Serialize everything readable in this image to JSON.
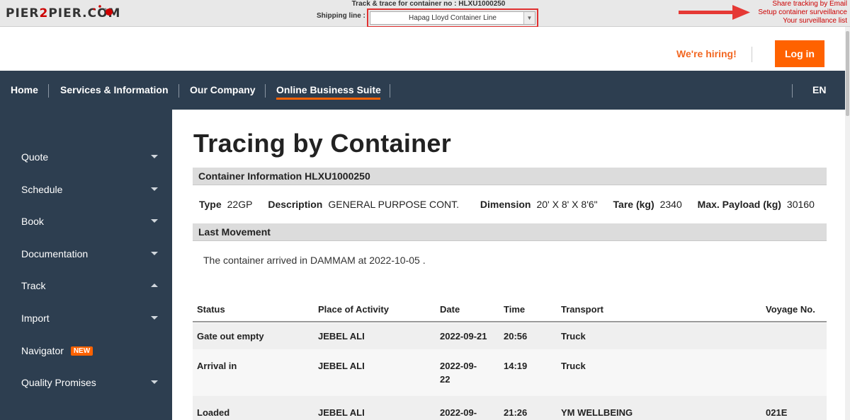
{
  "p2p": {
    "logo_text_a": "PIER",
    "logo_text_b": "2",
    "logo_text_c": "PIER.COM",
    "trace_title": "Track & trace for container no : HLXU1000250",
    "shipping_line_label": "Shipping line :",
    "shipping_line_value": "Hapag Lloyd Container Line",
    "links": [
      "Share tracking by Email",
      "Setup container surveillance",
      "Your surveillance list"
    ]
  },
  "header": {
    "hiring": "We're hiring!",
    "login": "Log in"
  },
  "nav": {
    "items": [
      "Home",
      "Services & Information",
      "Our Company",
      "Online Business Suite"
    ],
    "lang": "EN"
  },
  "sidebar": {
    "items": [
      {
        "label": "Quote",
        "caret": "down"
      },
      {
        "label": "Schedule",
        "caret": "down"
      },
      {
        "label": "Book",
        "caret": "down"
      },
      {
        "label": "Documentation",
        "caret": "down"
      },
      {
        "label": "Track",
        "caret": "up"
      },
      {
        "label": "Import",
        "caret": "down"
      },
      {
        "label": "Navigator",
        "badge": "NEW"
      },
      {
        "label": "Quality Promises",
        "caret": "down"
      }
    ]
  },
  "main": {
    "title": "Tracing by Container",
    "container_info_head": "Container Information HLXU1000250",
    "info": {
      "type_label": "Type",
      "type_value": "22GP",
      "desc_label": "Description",
      "desc_value": "GENERAL PURPOSE CONT.",
      "dim_label": "Dimension",
      "dim_value": "20' X 8' X 8'6\"",
      "tare_label": "Tare (kg)",
      "tare_value": "2340",
      "payload_label": "Max. Payload (kg)",
      "payload_value": "30160"
    },
    "last_movement_head": "Last Movement",
    "last_movement_text": "The container arrived in DAMMAM at 2022-10-05 .",
    "table": {
      "headers": [
        "Status",
        "Place of Activity",
        "Date",
        "Time",
        "Transport",
        "Voyage No."
      ],
      "rows": [
        {
          "status": "Gate out empty",
          "place": "JEBEL ALI",
          "date_a": "2022-09-21",
          "date_b": "",
          "time": "20:56",
          "transport": "Truck",
          "voyage": ""
        },
        {
          "status": "Arrival in",
          "place": "JEBEL ALI",
          "date_a": "2022-09-",
          "date_b": "22",
          "time": "14:19",
          "transport": "Truck",
          "voyage": ""
        },
        {
          "status": "Loaded",
          "place": "JEBEL ALI",
          "date_a": "2022-09-",
          "date_b": "",
          "time": "21:26",
          "transport": "YM WELLBEING",
          "voyage": "021E"
        }
      ]
    }
  }
}
